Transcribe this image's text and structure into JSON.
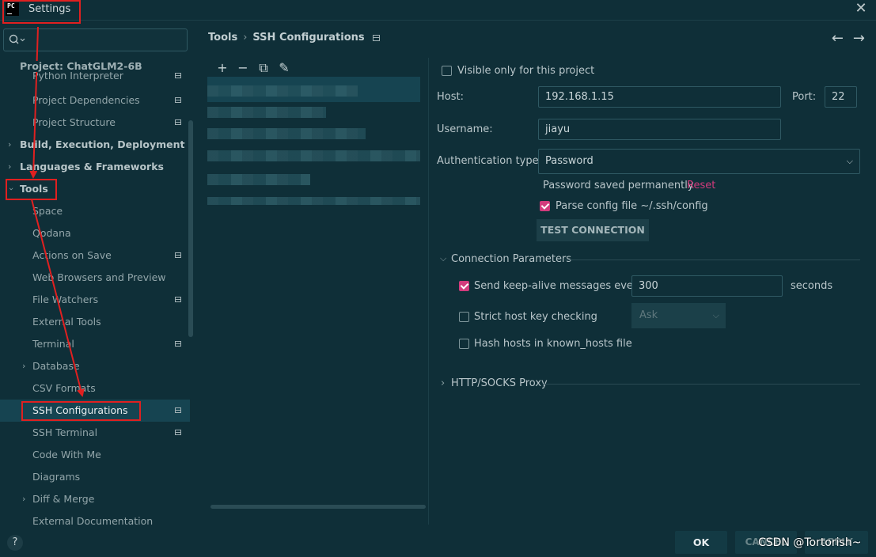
{
  "window": {
    "title": "Settings",
    "app_icon": "PC"
  },
  "sidebar": {
    "search_placeholder": "",
    "project": "Project: ChatGLM2-6B",
    "items": [
      {
        "label": "Python Interpreter"
      },
      {
        "label": "Project Dependencies"
      },
      {
        "label": "Project Structure"
      },
      {
        "label": "Build, Execution, Deployment"
      },
      {
        "label": "Languages & Frameworks"
      },
      {
        "label": "Tools"
      },
      {
        "label": "Space"
      },
      {
        "label": "Qodana"
      },
      {
        "label": "Actions on Save"
      },
      {
        "label": "Web Browsers and Preview"
      },
      {
        "label": "File Watchers"
      },
      {
        "label": "External Tools"
      },
      {
        "label": "Terminal"
      },
      {
        "label": "Database"
      },
      {
        "label": "CSV Formats"
      },
      {
        "label": "SSH Configurations"
      },
      {
        "label": "SSH Terminal"
      },
      {
        "label": "Code With Me"
      },
      {
        "label": "Diagrams"
      },
      {
        "label": "Diff & Merge"
      },
      {
        "label": "External Documentation"
      }
    ]
  },
  "header": {
    "breadcrumb_root": "Tools",
    "breadcrumb_current": "SSH Configurations",
    "separator": "›"
  },
  "toolbar": {
    "add": "+",
    "remove": "−",
    "copy": "⧉",
    "edit": "✎"
  },
  "form": {
    "visible_only_label": "Visible only for this project",
    "visible_only_checked": false,
    "host_label": "Host:",
    "host_value": "192.168.1.15",
    "port_label": "Port:",
    "port_value": "22",
    "username_label": "Username:",
    "username_value": "jiayu",
    "auth_label": "Authentication type:",
    "auth_value": "Password",
    "password_saved": "Password saved permanently",
    "reset": "Reset",
    "parse_config_label": "Parse config file ~/.ssh/config",
    "parse_config_checked": true,
    "test_button": "TEST CONNECTION",
    "connection_params": "Connection Parameters",
    "keepalive_label": "Send keep-alive messages every",
    "keepalive_checked": true,
    "keepalive_value": "300",
    "seconds": "seconds",
    "strict_host_label": "Strict host key checking",
    "strict_host_checked": false,
    "strict_host_select": "Ask",
    "hash_hosts_label": "Hash hosts in known_hosts file",
    "hash_hosts_checked": false,
    "proxy_section": "HTTP/SOCKS Proxy"
  },
  "footer": {
    "ok": "OK",
    "cancel": "CANCEL",
    "apply": "APPLY",
    "help": "?"
  },
  "watermark": "CSDN @Tortorish~",
  "colors": {
    "background": "#0f2f38",
    "accent": "#d23b7c",
    "annotation": "#e02020"
  }
}
